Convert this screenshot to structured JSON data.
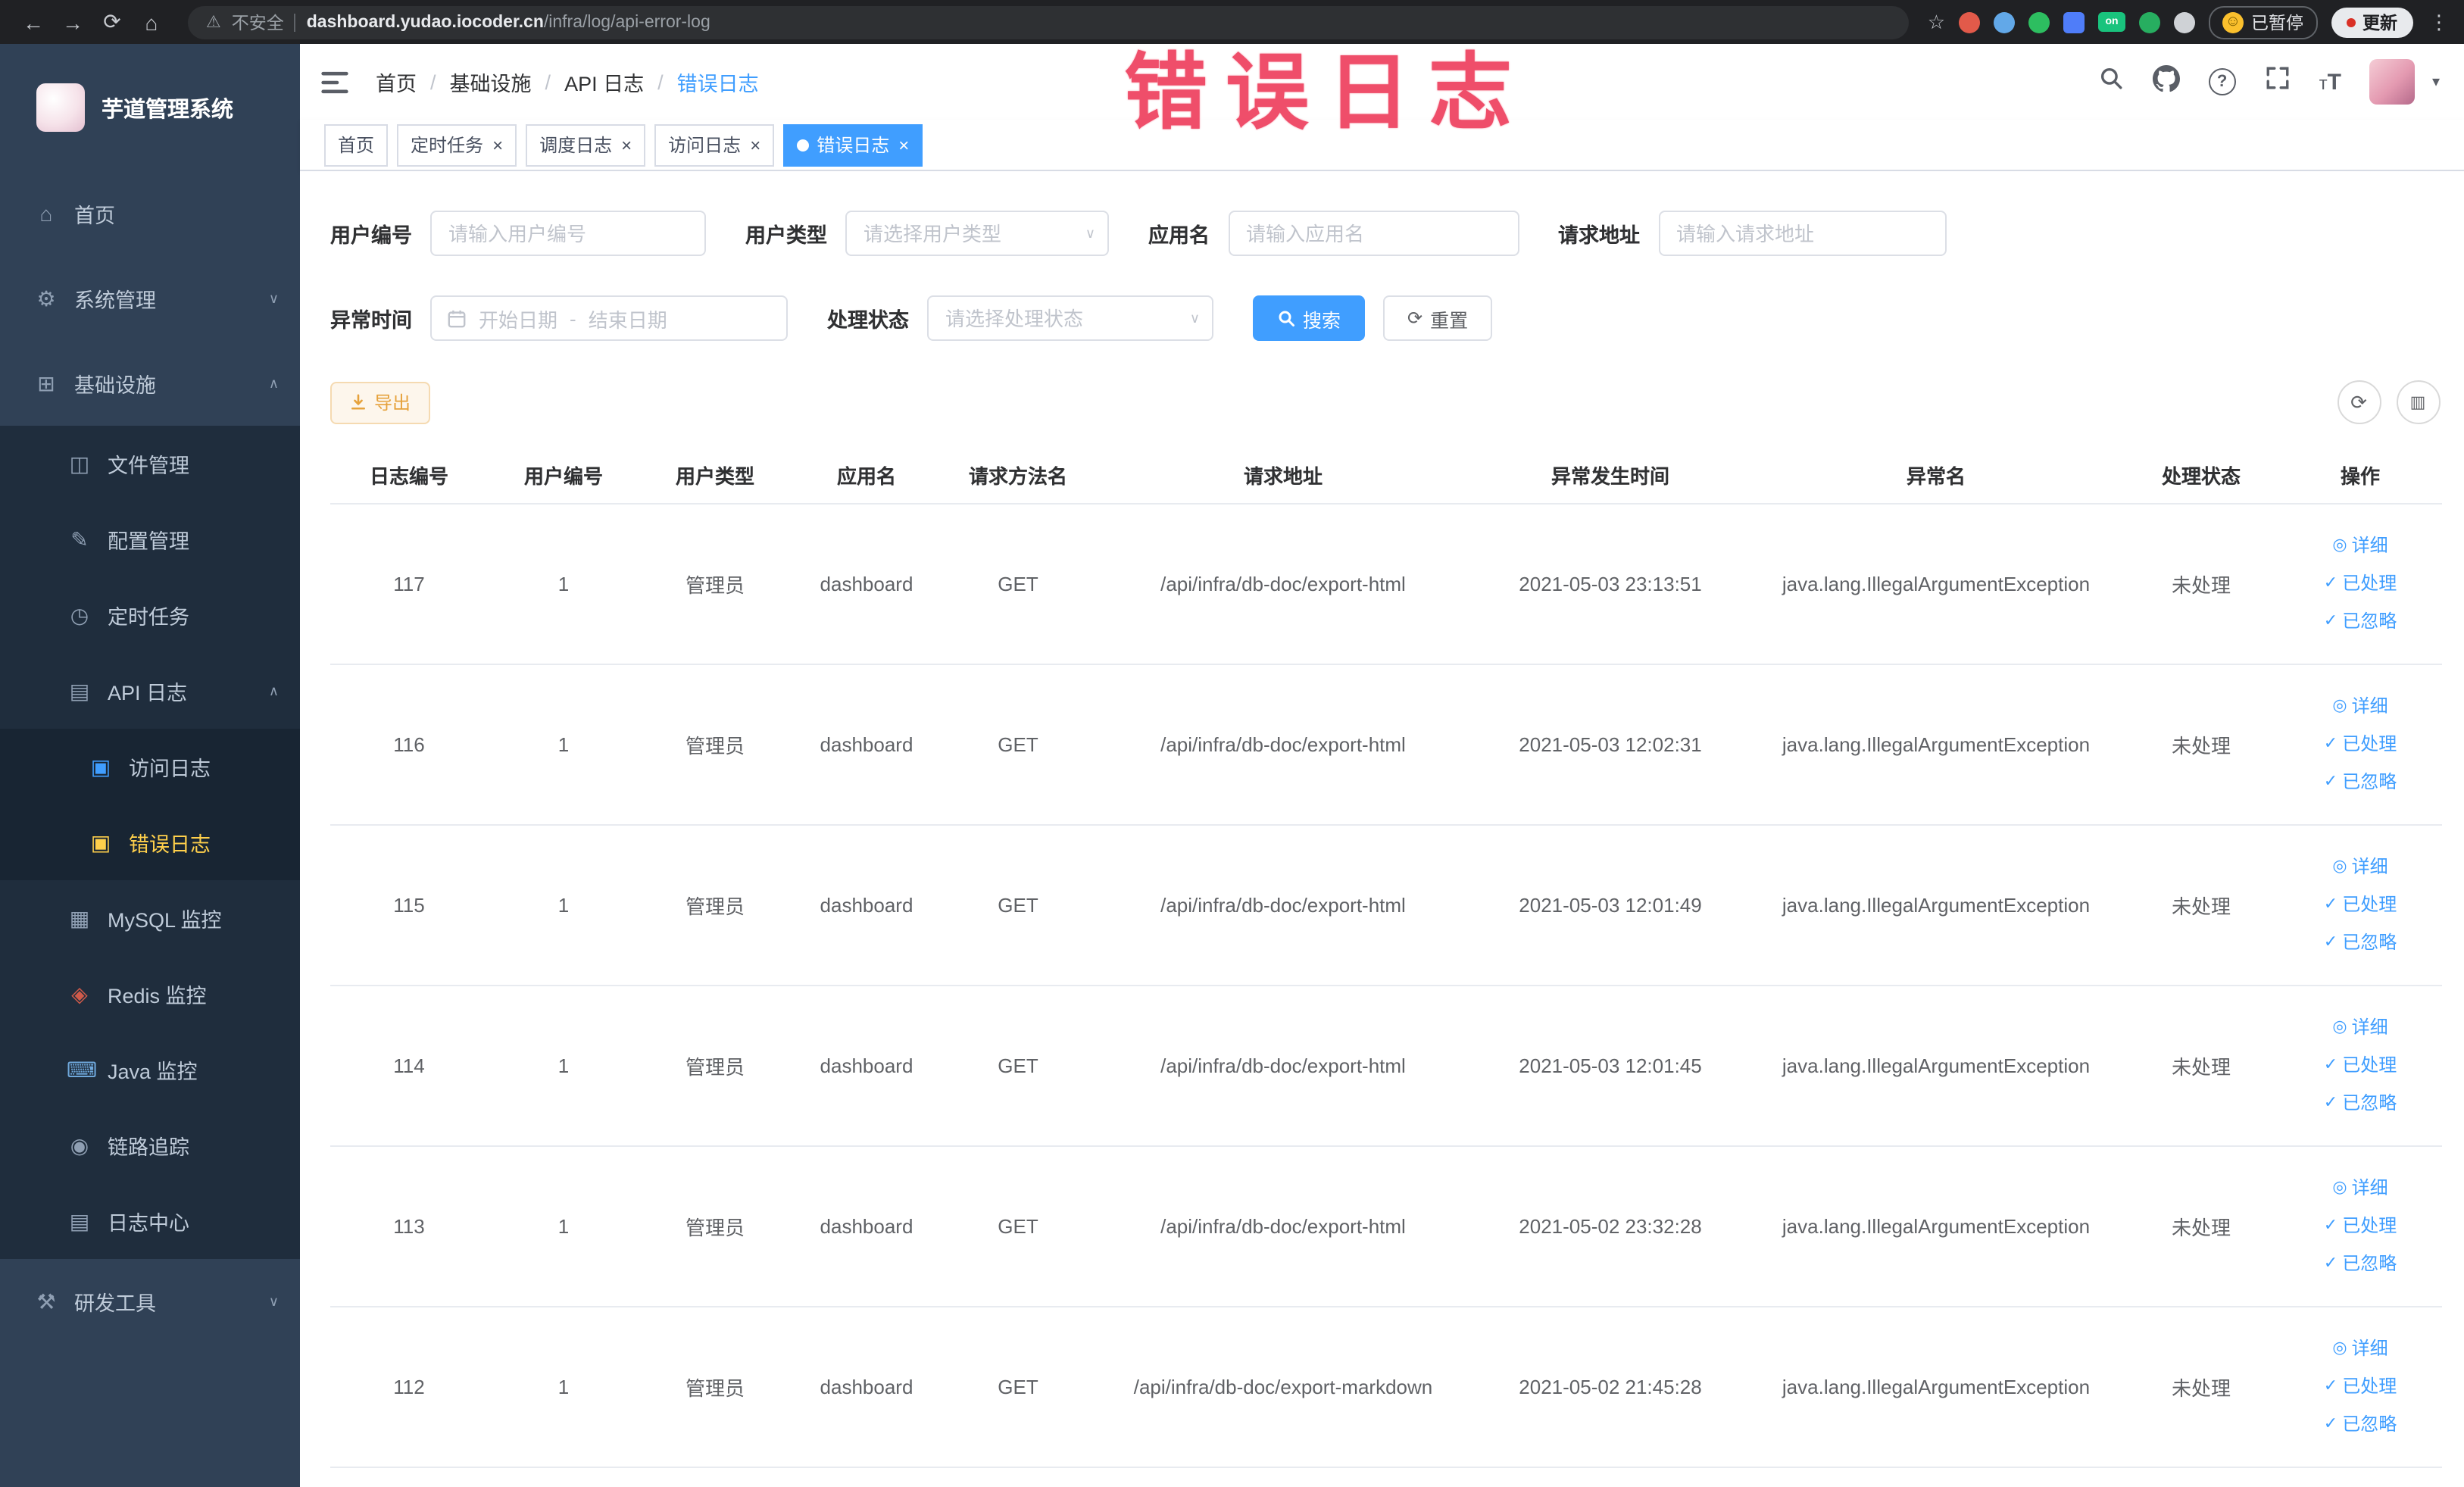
{
  "browser": {
    "security_label": "不安全",
    "url_domain": "dashboard.yudao.iocoder.cn",
    "url_path": "/infra/log/api-error-log",
    "paused_badge": "已暂停",
    "update_label": "更新"
  },
  "annotation": {
    "text": "错误日志"
  },
  "sidebar": {
    "logo_title": "芋道管理系统",
    "items": [
      {
        "label": "首页"
      },
      {
        "label": "系统管理"
      },
      {
        "label": "基础设施"
      },
      {
        "label": "文件管理"
      },
      {
        "label": "配置管理"
      },
      {
        "label": "定时任务"
      },
      {
        "label": "API 日志"
      },
      {
        "label": "访问日志"
      },
      {
        "label": "错误日志",
        "active": true
      },
      {
        "label": "MySQL 监控"
      },
      {
        "label": "Redis 监控"
      },
      {
        "label": "Java 监控"
      },
      {
        "label": "链路追踪"
      },
      {
        "label": "日志中心"
      },
      {
        "label": "研发工具"
      }
    ]
  },
  "header": {
    "breadcrumb": [
      "首页",
      "基础设施",
      "API 日志",
      "错误日志"
    ]
  },
  "tabs": [
    {
      "label": "首页"
    },
    {
      "label": "定时任务"
    },
    {
      "label": "调度日志"
    },
    {
      "label": "访问日志"
    },
    {
      "label": "错误日志",
      "active": true
    }
  ],
  "filters": {
    "user_id": {
      "label": "用户编号",
      "placeholder": "请输入用户编号"
    },
    "user_type": {
      "label": "用户类型",
      "placeholder": "请选择用户类型"
    },
    "app_name": {
      "label": "应用名",
      "placeholder": "请输入应用名"
    },
    "request_url": {
      "label": "请求地址",
      "placeholder": "请输入请求地址"
    },
    "exception_time": {
      "label": "异常时间",
      "start_placeholder": "开始日期",
      "separator": "-",
      "end_placeholder": "结束日期"
    },
    "process_status": {
      "label": "处理状态",
      "placeholder": "请选择处理状态"
    },
    "search_label": "搜索",
    "reset_label": "重置"
  },
  "toolbar": {
    "export_label": "导出"
  },
  "table": {
    "columns": [
      "日志编号",
      "用户编号",
      "用户类型",
      "应用名",
      "请求方法名",
      "请求地址",
      "异常发生时间",
      "异常名",
      "处理状态",
      "操作"
    ],
    "actions": [
      "详细",
      "已处理",
      "已忽略"
    ],
    "rows": [
      {
        "id": "117",
        "user_id": "1",
        "user_type": "管理员",
        "app": "dashboard",
        "method": "GET",
        "url": "/api/infra/db-doc/export-html",
        "time": "2021-05-03 23:13:51",
        "exception": "java.lang.IllegalArgumentException",
        "status": "未处理"
      },
      {
        "id": "116",
        "user_id": "1",
        "user_type": "管理员",
        "app": "dashboard",
        "method": "GET",
        "url": "/api/infra/db-doc/export-html",
        "time": "2021-05-03 12:02:31",
        "exception": "java.lang.IllegalArgumentException",
        "status": "未处理"
      },
      {
        "id": "115",
        "user_id": "1",
        "user_type": "管理员",
        "app": "dashboard",
        "method": "GET",
        "url": "/api/infra/db-doc/export-html",
        "time": "2021-05-03 12:01:49",
        "exception": "java.lang.IllegalArgumentException",
        "status": "未处理"
      },
      {
        "id": "114",
        "user_id": "1",
        "user_type": "管理员",
        "app": "dashboard",
        "method": "GET",
        "url": "/api/infra/db-doc/export-html",
        "time": "2021-05-03 12:01:45",
        "exception": "java.lang.IllegalArgumentException",
        "status": "未处理"
      },
      {
        "id": "113",
        "user_id": "1",
        "user_type": "管理员",
        "app": "dashboard",
        "method": "GET",
        "url": "/api/infra/db-doc/export-html",
        "time": "2021-05-02 23:32:28",
        "exception": "java.lang.IllegalArgumentException",
        "status": "未处理"
      },
      {
        "id": "112",
        "user_id": "1",
        "user_type": "管理员",
        "app": "dashboard",
        "method": "GET",
        "url": "/api/infra/db-doc/export-markdown",
        "time": "2021-05-02 21:45:28",
        "exception": "java.lang.IllegalArgumentException",
        "status": "未处理"
      }
    ]
  },
  "colors": {
    "accent": "#409eff",
    "menu_active": "#ffd04b",
    "warning": "#e6a23c",
    "annotation": "#ee3f5e"
  }
}
